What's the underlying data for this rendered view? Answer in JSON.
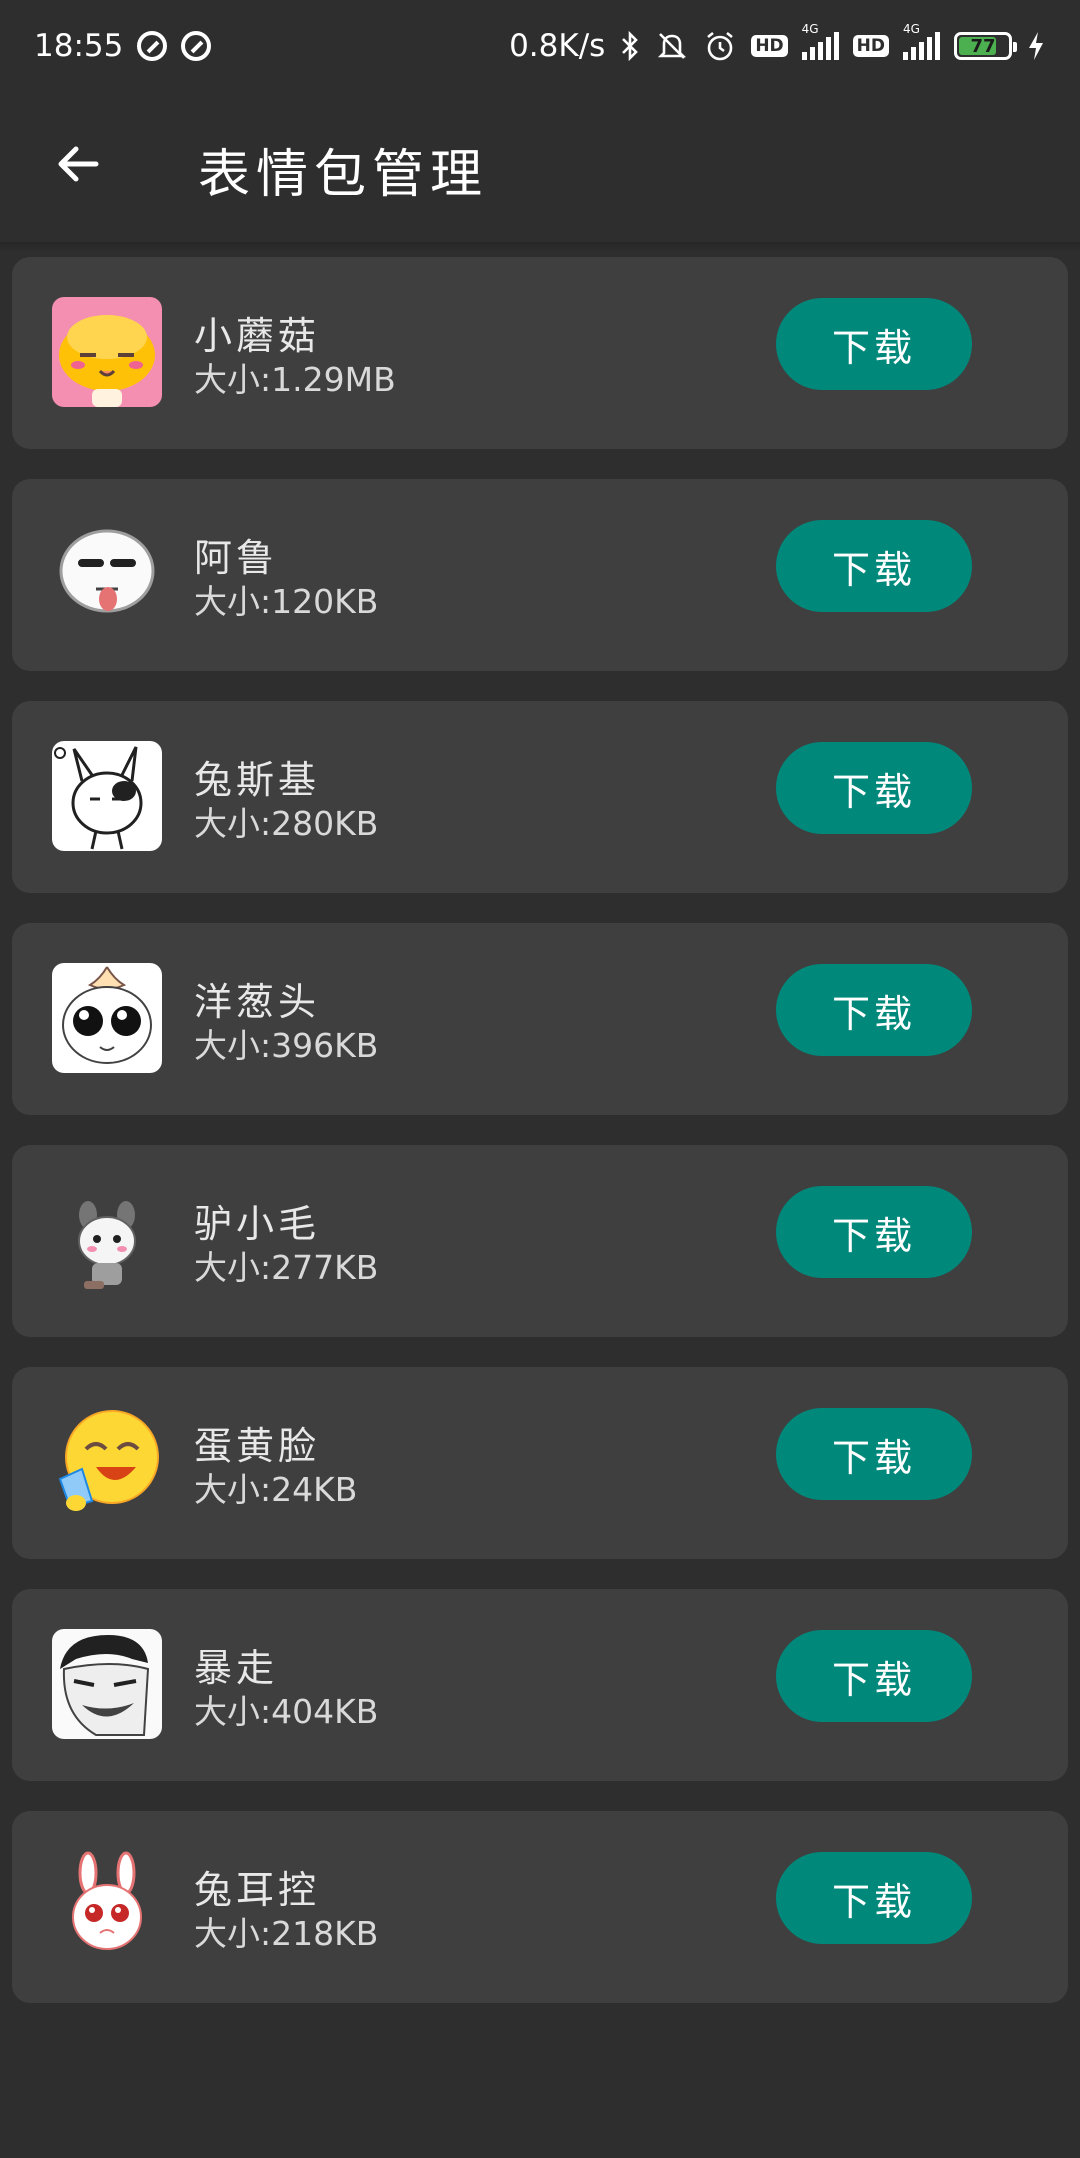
{
  "status_bar": {
    "time": "18:55",
    "speed": "0.8K/s",
    "hd": "HD",
    "network": "4G",
    "battery": "77",
    "battery_level": 0.77,
    "icons": [
      "vpn-icon",
      "vpn-icon",
      "bluetooth-icon",
      "mute-icon",
      "alarm-icon",
      "hd-icon",
      "signal-icon",
      "hd-icon",
      "signal-icon",
      "battery-icon",
      "charging-icon"
    ]
  },
  "header": {
    "back_icon": "arrow-left-icon",
    "title": "表情包管理"
  },
  "colors": {
    "background": "#2e2e2e",
    "card": "#3f3f3f",
    "accent": "#00897b",
    "battery_fill": "#4caf50"
  },
  "packs": [
    {
      "name": "小蘑菇",
      "size": "大小:1.29MB",
      "button": "下载",
      "icon": "mushroom-sticker-icon"
    },
    {
      "name": "阿鲁",
      "size": "大小:120KB",
      "button": "下载",
      "icon": "aru-face-sticker-icon"
    },
    {
      "name": "兔斯基",
      "size": "大小:280KB",
      "button": "下载",
      "icon": "tuzki-sticker-icon"
    },
    {
      "name": "洋葱头",
      "size": "大小:396KB",
      "button": "下载",
      "icon": "onion-head-sticker-icon"
    },
    {
      "name": "驴小毛",
      "size": "大小:277KB",
      "button": "下载",
      "icon": "donkey-sticker-icon"
    },
    {
      "name": "蛋黄脸",
      "size": "大小:24KB",
      "button": "下载",
      "icon": "yellow-face-sticker-icon"
    },
    {
      "name": "暴走",
      "size": "大小:404KB",
      "button": "下载",
      "icon": "rage-face-sticker-icon"
    },
    {
      "name": "兔耳控",
      "size": "大小:218KB",
      "button": "下载",
      "icon": "bunny-ears-sticker-icon"
    }
  ]
}
